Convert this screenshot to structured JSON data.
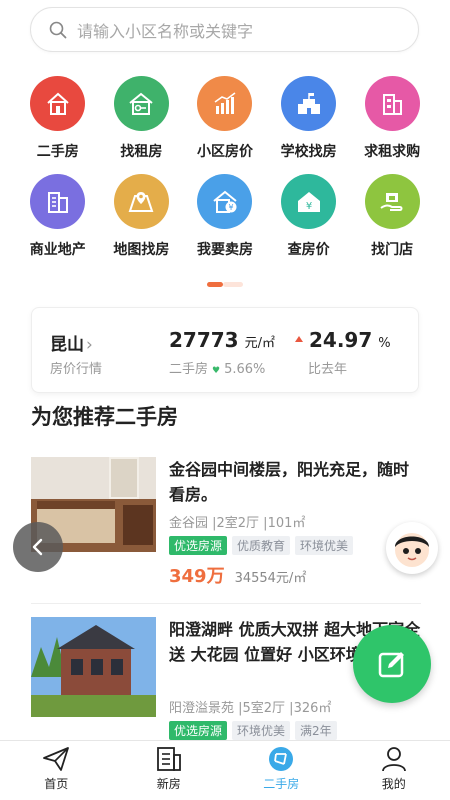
{
  "search": {
    "placeholder": "请输入小区名称或关键字",
    "icon": "search-icon"
  },
  "categories": [
    {
      "label": "二手房",
      "icon": "house-icon",
      "color": "#e8493f"
    },
    {
      "label": "找租房",
      "icon": "key-house-icon",
      "color": "#3fb26b"
    },
    {
      "label": "小区房价",
      "icon": "chart-up-icon",
      "color": "#f08a48"
    },
    {
      "label": "学校找房",
      "icon": "school-icon",
      "color": "#4a86e8"
    },
    {
      "label": "求租求购",
      "icon": "building-icon",
      "color": "#e659a6"
    },
    {
      "label": "商业地产",
      "icon": "office-icon",
      "color": "#7a6fe0"
    },
    {
      "label": "地图找房",
      "icon": "map-pin-icon",
      "color": "#e4ad4a"
    },
    {
      "label": "我要卖房",
      "icon": "sell-house-icon",
      "color": "#4aa0e8"
    },
    {
      "label": "查房价",
      "icon": "price-house-icon",
      "color": "#2eb89c"
    },
    {
      "label": "找门店",
      "icon": "store-icon",
      "color": "#8ec53f"
    }
  ],
  "price_card": {
    "city": "昆山",
    "city_sub": "房价行情",
    "price": "27773",
    "price_unit": "元/㎡",
    "price_label": "二手房",
    "price_change": "5.66%",
    "yoy": "24.97",
    "yoy_unit": "%",
    "yoy_label": "比去年"
  },
  "section_title": "为您推荐二手房",
  "listings": [
    {
      "title": "金谷园中间楼层，阳光充足，随时看房。",
      "meta": "金谷园 |2室2厅 |101㎡",
      "tags": [
        "优选房源",
        "优质教育",
        "环境优美"
      ],
      "price": "349万",
      "unit_price": "34554元/㎡"
    },
    {
      "title": "阳澄湖畔 优质大双拼 超大地下室全送 大花园 位置好 小区环境非常好",
      "meta": "阳澄溢景苑 |5室2厅 |326㎡",
      "tags": [
        "优选房源",
        "环境优美",
        "满2年"
      ]
    }
  ],
  "tabbar": [
    {
      "label": "首页",
      "icon": "paper-plane-icon"
    },
    {
      "label": "新房",
      "icon": "building-list-icon"
    },
    {
      "label": "二手房",
      "icon": "aperture-icon",
      "active": true
    },
    {
      "label": "我的",
      "icon": "person-icon"
    }
  ],
  "colors": {
    "accent_orange": "#ef6e3e",
    "green": "#2fb96a",
    "tab_active": "#3aa9e8"
  }
}
